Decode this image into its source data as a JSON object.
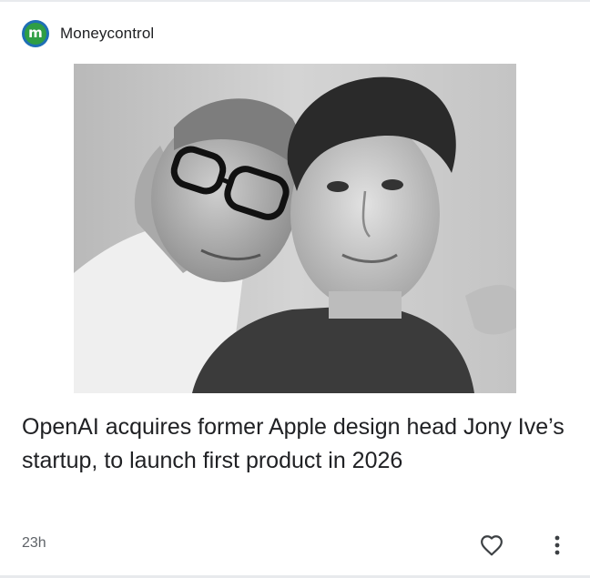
{
  "source": {
    "logo_letter": "m",
    "name": "Moneycontrol",
    "logo_colors": {
      "ring": "#1f6fb5",
      "fill": "#2f9e44"
    }
  },
  "article": {
    "image_icon": "photo-two-men-portrait",
    "headline": "OpenAI acquires former Apple design head Jony Ive’s startup, to launch first product in 2026",
    "time": "23h"
  },
  "actions": {
    "like_icon": "heart-outline-icon",
    "more_icon": "more-vert-icon"
  },
  "colors": {
    "text_primary": "#202124",
    "text_secondary": "#5f6368",
    "divider": "#e8eaed"
  }
}
